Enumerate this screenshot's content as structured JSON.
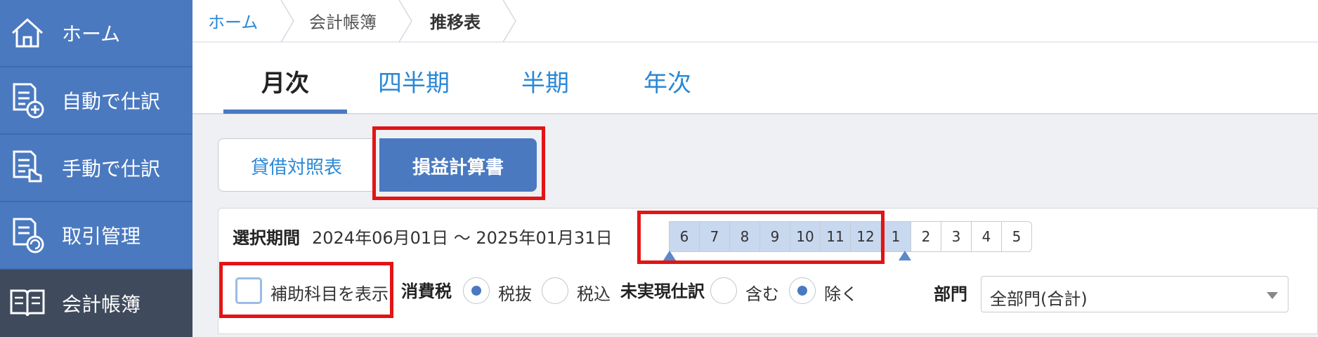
{
  "sidebar": {
    "items": [
      {
        "label": "ホーム",
        "icon": "home-icon"
      },
      {
        "label": "自動で仕訳",
        "icon": "document-add-icon"
      },
      {
        "label": "手動で仕訳",
        "icon": "document-hand-icon"
      },
      {
        "label": "取引管理",
        "icon": "document-sync-icon"
      },
      {
        "label": "会計帳簿",
        "icon": "book-icon"
      }
    ],
    "active_index": 4
  },
  "breadcrumb": [
    "ホーム",
    "会計帳簿",
    "推移表"
  ],
  "period_tabs": [
    "月次",
    "四半期",
    "半期",
    "年次"
  ],
  "report_tabs": {
    "left": "貸借対照表",
    "right": "損益計算書"
  },
  "filters": {
    "period_label": "選択期間",
    "period_range": "2024年06月01日 〜 2025年01月31日",
    "months": [
      "6",
      "7",
      "8",
      "9",
      "10",
      "11",
      "12",
      "1",
      "2",
      "3",
      "4",
      "5"
    ],
    "selected_months": [
      "6",
      "7",
      "8",
      "9",
      "10",
      "11",
      "12",
      "1"
    ],
    "sub_account_label": "補助科目を表示",
    "tax_label": "消費税",
    "tax_options": [
      "税抜",
      "税込"
    ],
    "tax_selected": "税抜",
    "unrealized_label": "未実現仕訳",
    "unrealized_options": [
      "含む",
      "除く"
    ],
    "unrealized_selected": "除く",
    "department_label": "部門",
    "department_value": "全部門(合計)"
  },
  "colors": {
    "brand": "#4a79c0",
    "sidebar_active": "#3f4a5c",
    "link": "#2b88d6",
    "highlight": "#e31414"
  }
}
